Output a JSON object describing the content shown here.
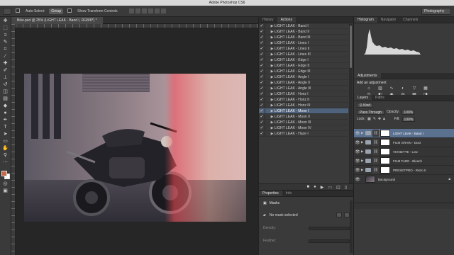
{
  "app": {
    "title": "Adobe Photoshop CS6"
  },
  "options_bar": {
    "auto_select_label": "Auto-Select:",
    "group_value": "Group",
    "show_transform_label": "Show Transform Controls",
    "workspace": "Photography"
  },
  "document": {
    "tab_title": "Bike.psd @ 25% (LIGHT LEAK - Band I, RGB/8*) *"
  },
  "actions_panel": {
    "tabs": [
      "History",
      "Actions"
    ],
    "active_tab": "Actions",
    "items": [
      "LIGHT LEAK - Band I",
      "LIGHT LEAK - Band II",
      "LIGHT LEAK - Band III",
      "LIGHT LEAK - Lines I",
      "LIGHT LEAK - Lines II",
      "LIGHT LEAK - Lines III",
      "LIGHT LEAK - Edge I",
      "LIGHT LEAK - Edge II",
      "LIGHT LEAK - Edge III",
      "LIGHT LEAK - Angle I",
      "LIGHT LEAK - Angle II",
      "LIGHT LEAK - Angle III",
      "LIGHT LEAK - Horiz I",
      "LIGHT LEAK - Horiz II",
      "LIGHT LEAK - Horiz III",
      "LIGHT LEAK - Moon I",
      "LIGHT LEAK - Moon II",
      "LIGHT LEAK - Moon III",
      "LIGHT LEAK - Moon IV",
      "LIGHT LEAK - Haze I"
    ],
    "selected_index": 15
  },
  "properties_panel": {
    "tabs": [
      "Properties",
      "Info"
    ],
    "active_tab": "Properties",
    "section": "Masks",
    "mask_status": "No mask selected",
    "fields": [
      "Density:",
      "Feather:"
    ]
  },
  "histogram_panel": {
    "tabs": [
      "Histogram",
      "Navigator",
      "Channels"
    ],
    "active_tab": "Histogram"
  },
  "adjustments_panel": {
    "tabs": [
      "Adjustments"
    ],
    "title": "Add an adjustment",
    "icons": [
      "brightness-icon",
      "levels-icon",
      "curves-icon",
      "exposure-icon",
      "vibrance-icon",
      "hue-saturation-icon",
      "color-balance-icon",
      "black-white-icon",
      "photo-filter-icon",
      "channel-mixer-icon",
      "color-lookup-icon",
      "invert-icon"
    ]
  },
  "layers_panel": {
    "tabs": [
      "Layers",
      "Paths"
    ],
    "active_tab": "Layers",
    "kind_filter": "Kind",
    "blend_mode": "Pass Through",
    "opacity_label": "Opacity:",
    "opacity_value": "100%",
    "lock_label": "Lock:",
    "fill_label": "Fill:",
    "fill_value": "100%",
    "layers": [
      {
        "name": "LIGHT LEAK - Band I",
        "type": "group",
        "selected": true
      },
      {
        "name": "FILM GRAIN - Dust",
        "type": "group",
        "selected": false
      },
      {
        "name": "VIGNETTE - Low",
        "type": "group",
        "selected": false
      },
      {
        "name": "FILM FADE - Bleach",
        "type": "group",
        "selected": false
      },
      {
        "name": "PRESETPRO - Retro II",
        "type": "group",
        "selected": false
      },
      {
        "name": "Background",
        "type": "image",
        "selected": false,
        "locked": true
      }
    ]
  },
  "colors": {
    "foreground": "#c46a4a",
    "background": "#ffffff",
    "selection": "#5b7190"
  }
}
